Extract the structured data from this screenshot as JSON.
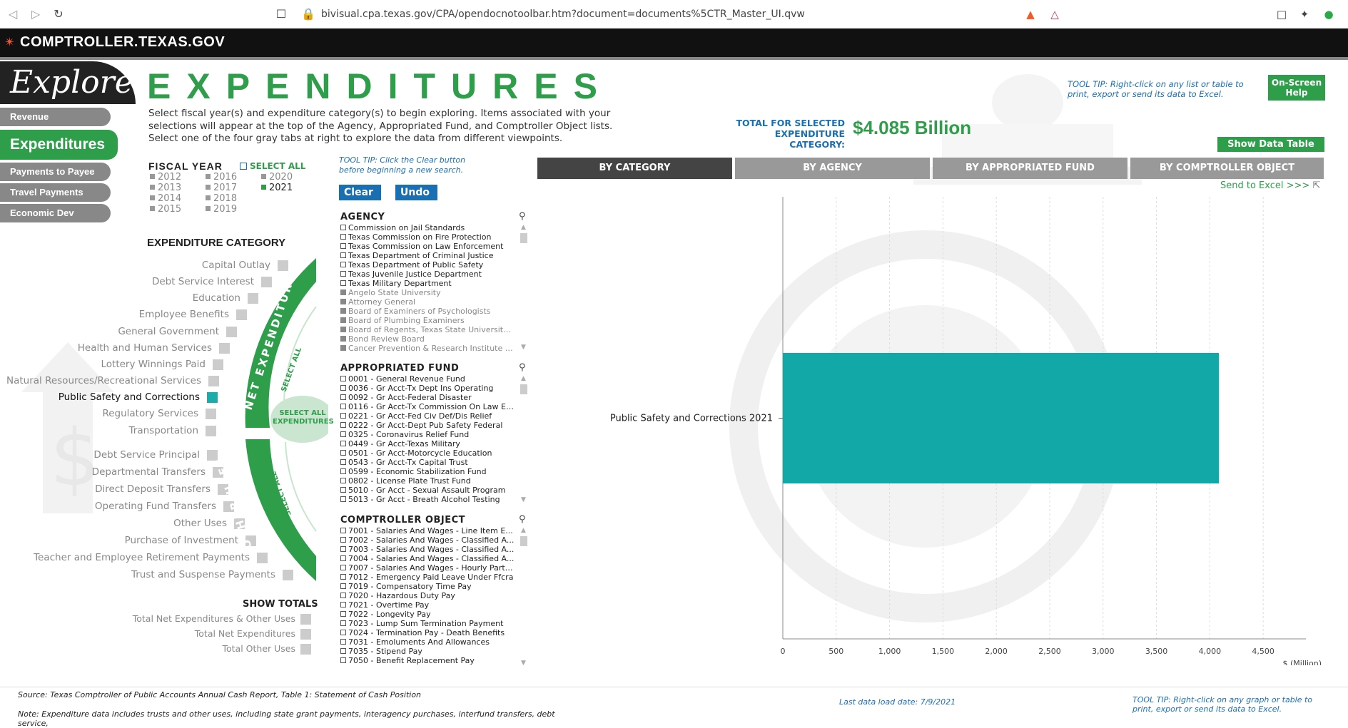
{
  "browser": {
    "url": "bivisual.cpa.texas.gov/CPA/opendocnotoolbar.htm?document=documents%5CTR_Master_UI.qvw"
  },
  "site": {
    "logo": "COMPTROLLER.TEXAS.GOV"
  },
  "nav": {
    "explore": "Explore",
    "revenue": "Revenue",
    "expenditures": "Expenditures",
    "payments": "Payments to Payee",
    "travel": "Travel Payments",
    "econdev": "Economic Dev"
  },
  "header": {
    "title": "EXPENDITURES",
    "intro": "Select fiscal year(s) and expenditure category(s) to begin exploring. Items associated with your selections will appear at the top of the Agency, Appropriated Fund, and Comptroller Object lists. Select one of the four gray tabs at right to explore the data from different viewpoints.",
    "total_label": "TOTAL FOR SELECTED EXPENDITURE CATEGORY:",
    "total_value": "$4.085 Billion",
    "tooltip": "TOOL TIP: Right-click on any list or table to print, export or send its data to Excel.",
    "help": "On-Screen Help",
    "show_table": "Show Data Table"
  },
  "fiscal_year": {
    "title": "FISCAL YEAR",
    "select_all": "SELECT ALL",
    "years": [
      "2012",
      "2013",
      "2014",
      "2015",
      "2016",
      "2017",
      "2018",
      "2019",
      "2020",
      "2021"
    ],
    "selected": "2021"
  },
  "controls": {
    "tooltip": "TOOL TIP: Click the Clear button before beginning a new search.",
    "clear": "Clear",
    "undo": "Undo"
  },
  "categories": {
    "title": "EXPENDITURE CATEGORY",
    "net": [
      "Capital Outlay",
      "Debt Service Interest",
      "Education",
      "Employee Benefits",
      "General Government",
      "Health and Human Services",
      "Lottery Winnings Paid",
      "Natural Resources/Recreational Services",
      "Public Safety and Corrections",
      "Regulatory Services",
      "Transportation"
    ],
    "other": [
      "Debt Service Principal",
      "Departmental Transfers",
      "Direct Deposit Transfers",
      "Operating Fund Transfers",
      "Other Uses",
      "Purchase of Investment",
      "Teacher and Employee Retirement Payments",
      "Trust and Suspense Payments"
    ],
    "selected": "Public Safety and Corrections",
    "net_label": "NET EXPENDITURES",
    "other_label": "OTHER USES",
    "select_all_label": "SELECT ALL",
    "select_all_exp": "SELECT ALL EXPENDITURES"
  },
  "totals": {
    "title": "SHOW TOTALS",
    "items": [
      "Total Net Expenditures & Other Uses",
      "Total Net Expenditures",
      "Total Other Uses"
    ]
  },
  "agency": {
    "title": "AGENCY",
    "items": [
      {
        "label": "Commission on Jail Standards",
        "grey": false
      },
      {
        "label": "Texas Commission on Fire Protection",
        "grey": false
      },
      {
        "label": "Texas Commission on Law Enforcement",
        "grey": false
      },
      {
        "label": "Texas Department of Criminal Justice",
        "grey": false
      },
      {
        "label": "Texas Department of Public Safety",
        "grey": false
      },
      {
        "label": "Texas Juvenile Justice Department",
        "grey": false
      },
      {
        "label": "Texas Military Department",
        "grey": false
      },
      {
        "label": "Angelo State University",
        "grey": true
      },
      {
        "label": "Attorney General",
        "grey": true
      },
      {
        "label": "Board of Examiners of Psychologists",
        "grey": true
      },
      {
        "label": "Board of Plumbing Examiners",
        "grey": true
      },
      {
        "label": "Board of Regents, Texas State University ...",
        "grey": true
      },
      {
        "label": "Bond Review Board",
        "grey": true
      },
      {
        "label": "Cancer Prevention & Research Institute of...",
        "grey": true
      }
    ]
  },
  "fund": {
    "title": "APPROPRIATED FUND",
    "items": [
      "0001 - General Revenue Fund",
      "0036 - Gr Acct-Tx Dept Ins Operating",
      "0092 - Gr Acct-Federal Disaster",
      "0116 - Gr Acct-Tx Commission On Law En...",
      "0221 - Gr Acct-Fed Civ Def/Dis Relief",
      "0222 - Gr Acct-Dept Pub Safety Federal",
      "0325 - Coronavirus Relief Fund",
      "0449 - Gr Acct-Texas Military",
      "0501 - Gr Acct-Motorcycle Education",
      "0543 - Gr Acct-Tx Capital Trust",
      "0599 - Economic Stabilization Fund",
      "0802 - License Plate Trust Fund",
      "5010 - Gr Acct - Sexual Assault Program",
      "5013 - Gr Acct - Breath Alcohol Testing"
    ]
  },
  "object": {
    "title": "COMPTROLLER OBJECT",
    "items": [
      "7001 - Salaries And Wages - Line Item E...",
      "7002 - Salaries And Wages - Classified A...",
      "7003 - Salaries And Wages - Classified A...",
      "7004 - Salaries And Wages - Classified A...",
      "7007 - Salaries And Wages - Hourly Part-...",
      "7012 - Emergency Paid Leave Under Ffcra",
      "7019 - Compensatory Time Pay",
      "7020 - Hazardous Duty Pay",
      "7021 - Overtime Pay",
      "7022 - Longevity Pay",
      "7023 - Lump Sum Termination Payment",
      "7024 - Termination Pay - Death Benefits",
      "7031 - Emoluments And Allowances",
      "7035 - Stipend Pay",
      "7050 - Benefit Replacement Pay"
    ]
  },
  "tabs": [
    "BY CATEGORY",
    "BY AGENCY",
    "BY APPROPRIATED FUND",
    "BY COMPTROLLER OBJECT"
  ],
  "send_excel": "Send to Excel >>>",
  "chart_data": {
    "type": "bar",
    "orientation": "horizontal",
    "categories": [
      "Public Safety and Corrections  2021"
    ],
    "values": [
      4085
    ],
    "xlabel": "$ (Million)",
    "xticks": [
      0,
      500,
      1000,
      1500,
      2000,
      2500,
      3000,
      3500,
      4000,
      4500
    ],
    "xtick_labels": [
      "0",
      "500",
      "1,000",
      "1,500",
      "2,000",
      "2,500",
      "3,000",
      "3,500",
      "4,000",
      "4,500"
    ],
    "xlim": [
      0,
      4900
    ],
    "bar_color": "#13a8a8",
    "grid": true
  },
  "footer": {
    "source": "Source: Texas Comptroller of Public Accounts Annual Cash Report, Table 1: Statement of Cash Position",
    "note": "Note: Expenditure data includes trusts and other uses, including state grant payments, interagency purchases, interfund transfers, debt service,",
    "load_date": "Last data load date:  7/9/2021",
    "tooltip": "TOOL TIP: Right-click on any graph or table to print, export or send its data to Excel."
  }
}
